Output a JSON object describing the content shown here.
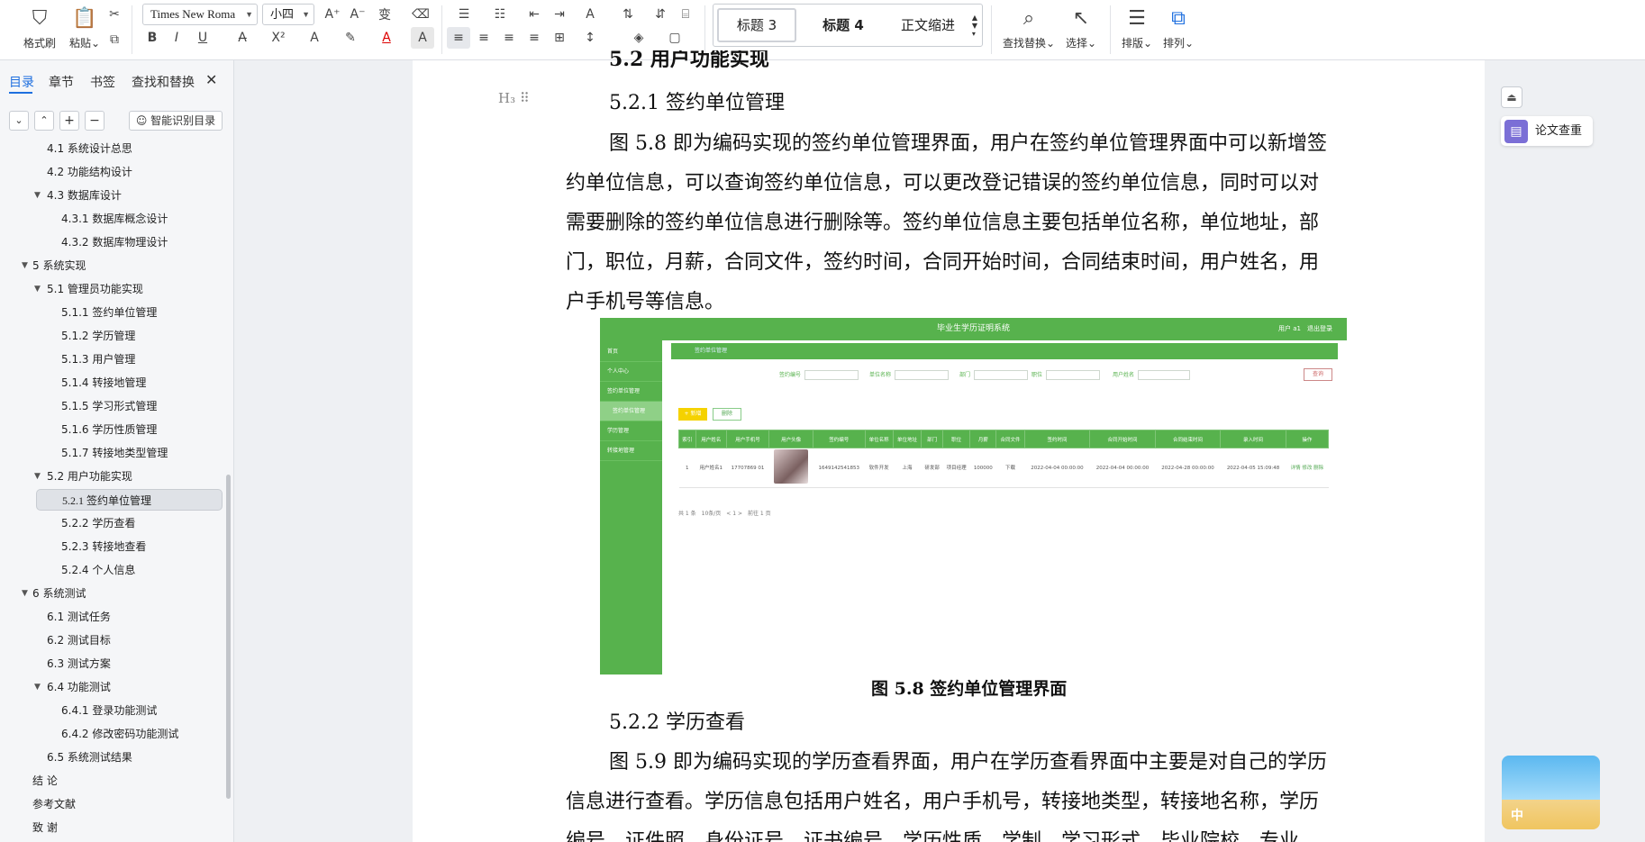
{
  "ribbon": {
    "format_painter": "格式刷",
    "paste": "粘贴",
    "font_name": "Times New Roma",
    "font_size": "小四",
    "styles": [
      "标题 3",
      "标题 4",
      "正文缩进"
    ],
    "find_replace": "查找替换",
    "select": "选择",
    "layout": "排版",
    "arrange": "排列"
  },
  "nav": {
    "tabs": [
      "目录",
      "章节",
      "书签",
      "查找和替换"
    ],
    "smart_toc": "智能识别目录",
    "toc": [
      {
        "label": "4.1 系统设计总思",
        "level": 2
      },
      {
        "label": "4.2 功能结构设计",
        "level": 2
      },
      {
        "label": "4.3 数据库设计",
        "level": 2,
        "arrow": true
      },
      {
        "label": "4.3.1 数据库概念设计",
        "level": 3
      },
      {
        "label": "4.3.2 数据库物理设计",
        "level": 3
      },
      {
        "label": "5 系统实现",
        "level": 1,
        "arrow": true
      },
      {
        "label": "5.1 管理员功能实现",
        "level": 2,
        "arrow": true
      },
      {
        "label": "5.1.1 签约单位管理",
        "level": 3
      },
      {
        "label": "5.1.2 学历管理",
        "level": 3
      },
      {
        "label": "5.1.3 用户管理",
        "level": 3
      },
      {
        "label": "5.1.4 转接地管理",
        "level": 3
      },
      {
        "label": "5.1.5 学习形式管理",
        "level": 3
      },
      {
        "label": "5.1.6 学历性质管理",
        "level": 3
      },
      {
        "label": "5.1.7 转接地类型管理",
        "level": 3
      },
      {
        "label": "5.2 用户功能实现",
        "level": 2,
        "arrow": true
      },
      {
        "label": "5.2.1 签约单位管理",
        "level": 3,
        "selected": true
      },
      {
        "label": "5.2.2 学历查看",
        "level": 3
      },
      {
        "label": "5.2.3 转接地查看",
        "level": 3
      },
      {
        "label": "5.2.4 个人信息",
        "level": 3
      },
      {
        "label": "6 系统测试",
        "level": 1,
        "arrow": true
      },
      {
        "label": "6.1 测试任务",
        "level": 2
      },
      {
        "label": "6.2 测试目标",
        "level": 2
      },
      {
        "label": "6.3 测试方案",
        "level": 2
      },
      {
        "label": "6.4 功能测试",
        "level": 2,
        "arrow": true
      },
      {
        "label": "6.4.1 登录功能测试",
        "level": 3
      },
      {
        "label": "6.4.2 修改密码功能测试",
        "level": 3
      },
      {
        "label": "6.5 系统测试结果",
        "level": 2
      },
      {
        "label": "结 论",
        "level": 1
      },
      {
        "label": "参考文献",
        "level": 1
      },
      {
        "label": "致 谢",
        "level": 1
      }
    ]
  },
  "doc": {
    "h2_partial": "5.2 用户功能实现",
    "h3_a": "5.2.1 签约单位管理",
    "para1": [
      "图 5.8 即为编码实现的签约单位管理界面，用户在签约单位管理界面中可以新增签",
      "约单位信息，可以查询签约单位信息，可以更改登记错误的签约单位信息，同时可以对",
      "需要删除的签约单位信息进行删除等。签约单位信息主要包括单位名称，单位地址，部",
      "门，职位，月薪，合同文件，签约时间，合同开始时间，合同结束时间，用户姓名，用",
      "户手机号等信息。"
    ],
    "figure_caption": "图 5.8 签约单位管理界面",
    "h3_b": "5.2.2 学历查看",
    "para2": [
      "图 5.9 即为编码实现的学历查看界面，用户在学历查看界面中主要是对自己的学历",
      "信息进行查看。学历信息包括用户姓名，用户手机号，转接地类型，转接地名称，学历",
      "编号，证件照，身份证号，证书编号，学历性质，学制，学习形式，毕业院校，专业，"
    ]
  },
  "figure": {
    "system_title": "毕业生学历证明系统",
    "user_info": "用户 a1　退出登录",
    "sidebar": [
      "首页",
      "个人中心",
      "签约单位管理",
      "签约单位管理",
      "学历管理",
      "转接地管理"
    ],
    "search_fields": [
      "签约编号",
      "单位名称",
      "部门",
      "职位",
      "用户姓名"
    ],
    "search_button": "查询",
    "add_button": "+ 新增",
    "delete_button": "删除",
    "columns": [
      "索引",
      "用户姓名",
      "用户手机号",
      "用户头像",
      "签约编号",
      "单位名称",
      "单位地址",
      "部门",
      "职位",
      "月薪",
      "合同文件",
      "签约时间",
      "合同开始时间",
      "合同结束时间",
      "录入时间",
      "操作"
    ],
    "row": [
      "1",
      "用户姓名1",
      "17707869 01",
      "",
      "1649142541853",
      "软件开发",
      "上海",
      "研发部",
      "项目经理",
      "100000",
      "下载",
      "2022-04-04 00:00:00",
      "2022-04-04 00:00:00",
      "2022-04-28 00:00:00",
      "2022-04-05 15:09:48",
      "详情 修改 删除"
    ],
    "pager": "共 1 条　10条/页　< 1 >　前往 1 页"
  },
  "right": {
    "thesis_check": "论文查重",
    "widget_text": "中"
  },
  "colors": {
    "accent": "#1e6fdf",
    "figure_green": "#57b24d"
  }
}
